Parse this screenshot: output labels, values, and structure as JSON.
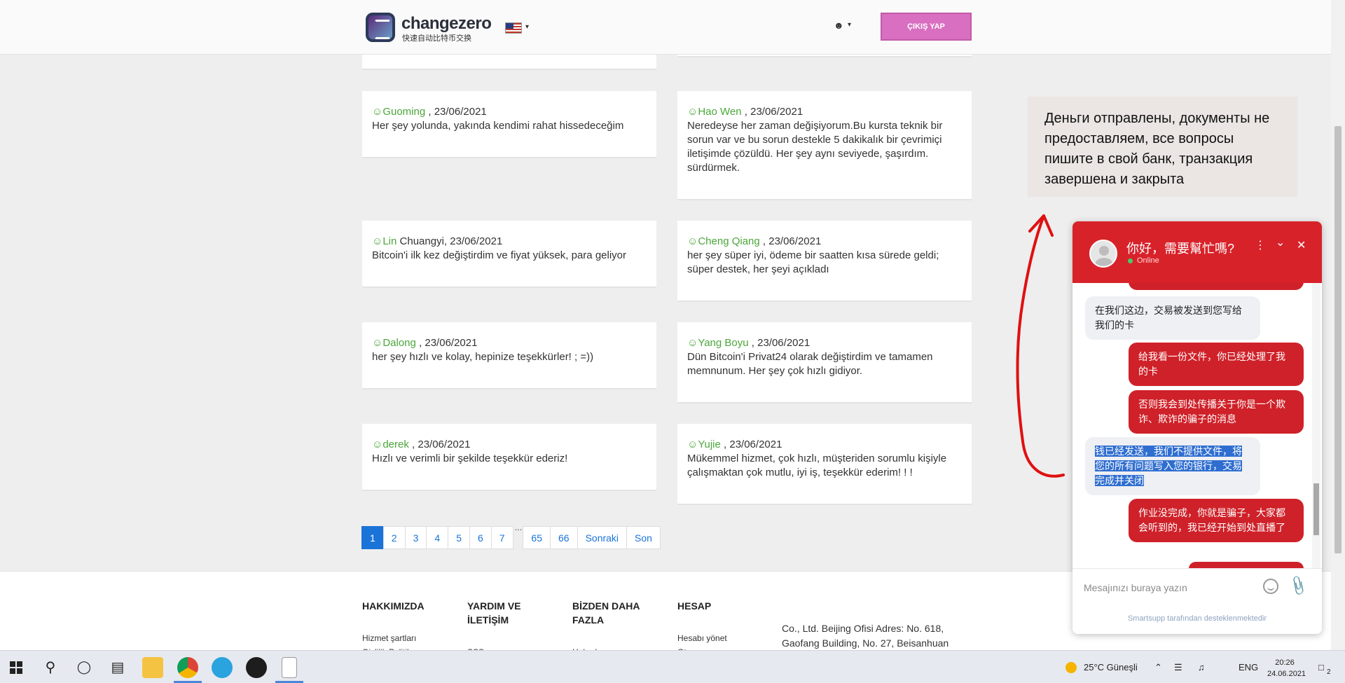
{
  "header": {
    "brand": "changezero",
    "brand_sub": "快速自动比特币交换",
    "logout_label": "ÇIKIŞ YAP",
    "caret": "▾"
  },
  "reviews": [
    {
      "smiley": "☺",
      "name": "Guoming",
      "rest": " , 23/06/2021",
      "text": "Her şey yolunda, yakında kendimi rahat hissedeceğim"
    },
    {
      "smiley": "☺",
      "name": "Hao Wen",
      "rest": " , 23/06/2021",
      "text": "Neredeyse her zaman değişiyorum.Bu kursta teknik bir sorun var ve bu sorun destekle 5 dakikalık bir çevrimiçi iletişimde çözüldü. Her şey aynı seviyede, şaşırdım. sürdürmek."
    },
    {
      "smiley": "☺",
      "name": "Lin",
      "rest": " Chuangyi, 23/06/2021",
      "text": "Bitcoin'i ilk kez değiştirdim ve fiyat yüksek, para geliyor"
    },
    {
      "smiley": "☺",
      "name": "Cheng Qiang",
      "rest": " , 23/06/2021",
      "text": "her şey süper iyi, ödeme bir saatten kısa sürede geldi; süper destek, her şeyi açıkladı"
    },
    {
      "smiley": "☺",
      "name": "Dalong",
      "rest": " , 23/06/2021",
      "text": "her şey hızlı ve kolay, hepinize teşekkürler! ; =))"
    },
    {
      "smiley": "☺",
      "name": "Yang Boyu",
      "rest": " , 23/06/2021",
      "text": "Dün Bitcoin'i Privat24 olarak değiştirdim ve tamamen memnunum. Her şey çok hızlı gidiyor."
    },
    {
      "smiley": "☺",
      "name": "derek",
      "rest": " , 23/06/2021",
      "text": "Hızlı ve verimli bir şekilde teşekkür ederiz!"
    },
    {
      "smiley": "☺",
      "name": "Yujie",
      "rest": " , 23/06/2021",
      "text": "Mükemmel hizmet, çok hızlı, müşteriden sorumlu kişiyle çalışmaktan çok mutlu, iyi iş, teşekkür ederim! ! !"
    }
  ],
  "pagination": {
    "pages": [
      "1",
      "2",
      "3",
      "4",
      "5",
      "6",
      "7"
    ],
    "dots": "...",
    "more": [
      "65",
      "66"
    ],
    "next": "Sonraki",
    "last": "Son",
    "current": "1"
  },
  "footer": {
    "col1_head": "HAKKIMIZDA",
    "col1_links": [
      "Hizmet şartları",
      "Gizlilik Politikası"
    ],
    "col2_head": "YARDIM VE İLETİŞİM",
    "col2_links": [
      "SSS"
    ],
    "col3_head": "BİZDEN DAHA FAZLA",
    "col3_links": [
      "Haberler"
    ],
    "col4_head": "HESAP",
    "col4_links": [
      "Hesabı yönet",
      "Oturum aç"
    ],
    "address": "Co., Ltd. Beijing Ofisi Adres: No. 618, Gaofang Building, No. 27, Beisanhuan"
  },
  "note": {
    "text": "Деньги отправлены, документы не предоставляем, все вопросы пишите в свой банк, транзакция завершена и закрыта"
  },
  "chat": {
    "title": "你好，需要幫忙嗎?",
    "status": "Online",
    "menu_icon": "⋮",
    "minimize_icon": "⌄",
    "close_icon": "✕",
    "messages": [
      {
        "dir": "in",
        "text": "在我们这边，交易被发送到您写给我们的卡"
      },
      {
        "dir": "out",
        "text": "给我看一份文件，你已经处理了我的卡"
      },
      {
        "dir": "out",
        "text": "否则我会到处传播关于你是一个欺诈、欺诈的骗子的消息"
      },
      {
        "dir": "in",
        "text": "钱已经发送，我们不提供文件，将您的所有问题写入您的银行，交易完成并关闭"
      },
      {
        "dir": "out",
        "text": "作业没完成，你就是骗子，大家都会听到的，我已经开始到处直播了"
      }
    ],
    "input_placeholder": "Mesajınızı buraya yazın",
    "powered_by": "Smartsupp tarafından desteklenmektedir"
  },
  "taskbar": {
    "weather": "25°C  Güneşli",
    "lang": "ENG",
    "time": "20:26",
    "date": "24.06.2021",
    "notifications": "2"
  }
}
